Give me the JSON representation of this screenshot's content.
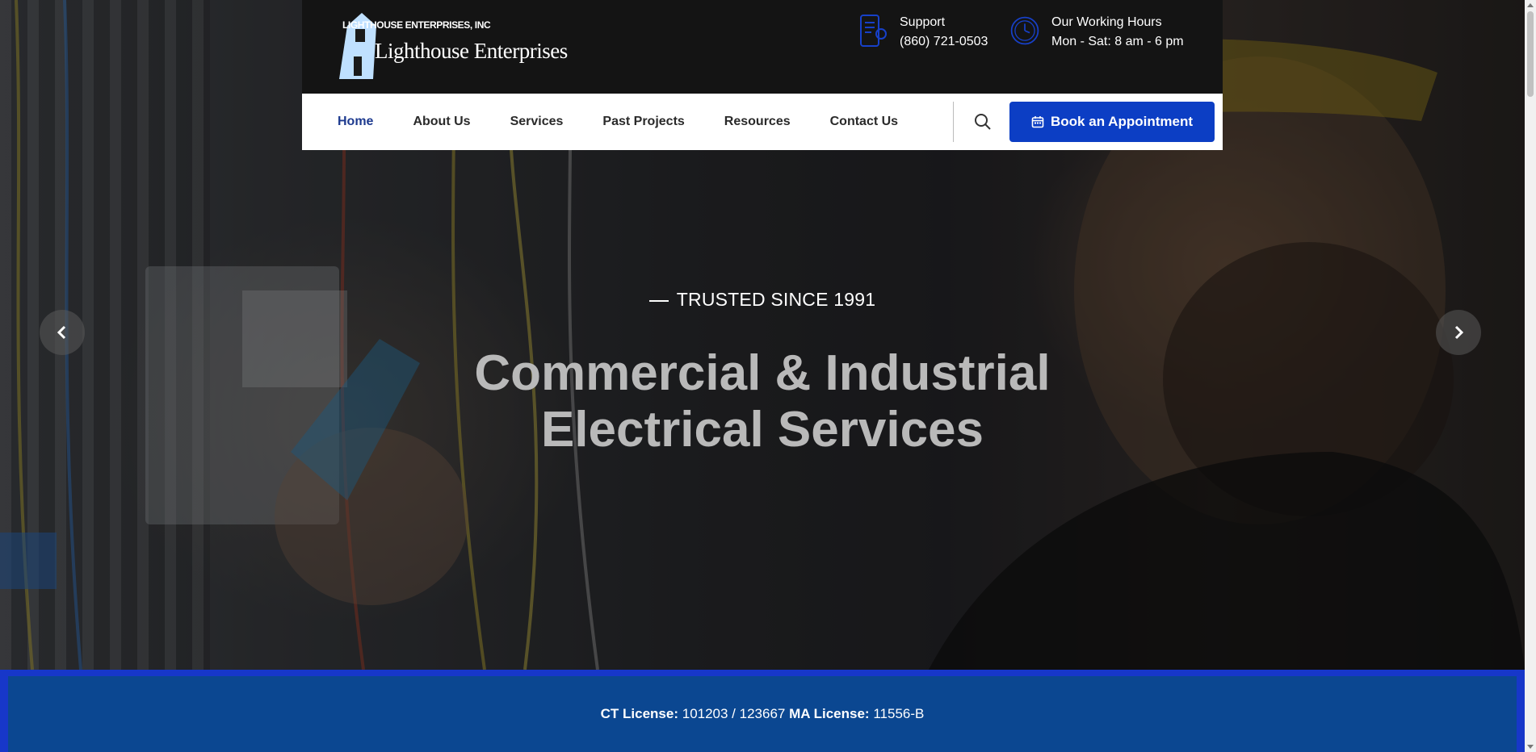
{
  "brand": {
    "company_small": "LIGHTHOUSE ENTERPRISES, INC",
    "company_big": "Lighthouse Enterprises"
  },
  "topbar": {
    "support_label": "Support",
    "support_phone": "(860) 721-0503",
    "hours_label": "Our Working Hours",
    "hours_value": "Mon - Sat: 8 am - 6 pm"
  },
  "nav": {
    "items": [
      {
        "label": "Home",
        "active": true
      },
      {
        "label": "About Us"
      },
      {
        "label": "Services"
      },
      {
        "label": "Past Projects"
      },
      {
        "label": "Resources"
      },
      {
        "label": "Contact Us"
      }
    ],
    "search_icon": "search-icon",
    "book_label": "Book an Appointment",
    "book_icon": "calendar-icon"
  },
  "hero": {
    "eyebrow": "TRUSTED SINCE 1991",
    "headline_line1": "Commercial & Industrial",
    "headline_line2": "Electrical Services",
    "prev_icon": "chevron-left-icon",
    "next_icon": "chevron-right-icon"
  },
  "license": {
    "ct_label": "CT License:",
    "ct_value": "101203 / 123667",
    "ma_label": "MA License:",
    "ma_value": "11556-B"
  },
  "colors": {
    "accent": "#0c3ec4",
    "nav_active": "#1d3a8f",
    "license_bar": "#0b4791",
    "license_border": "#1737c9"
  }
}
